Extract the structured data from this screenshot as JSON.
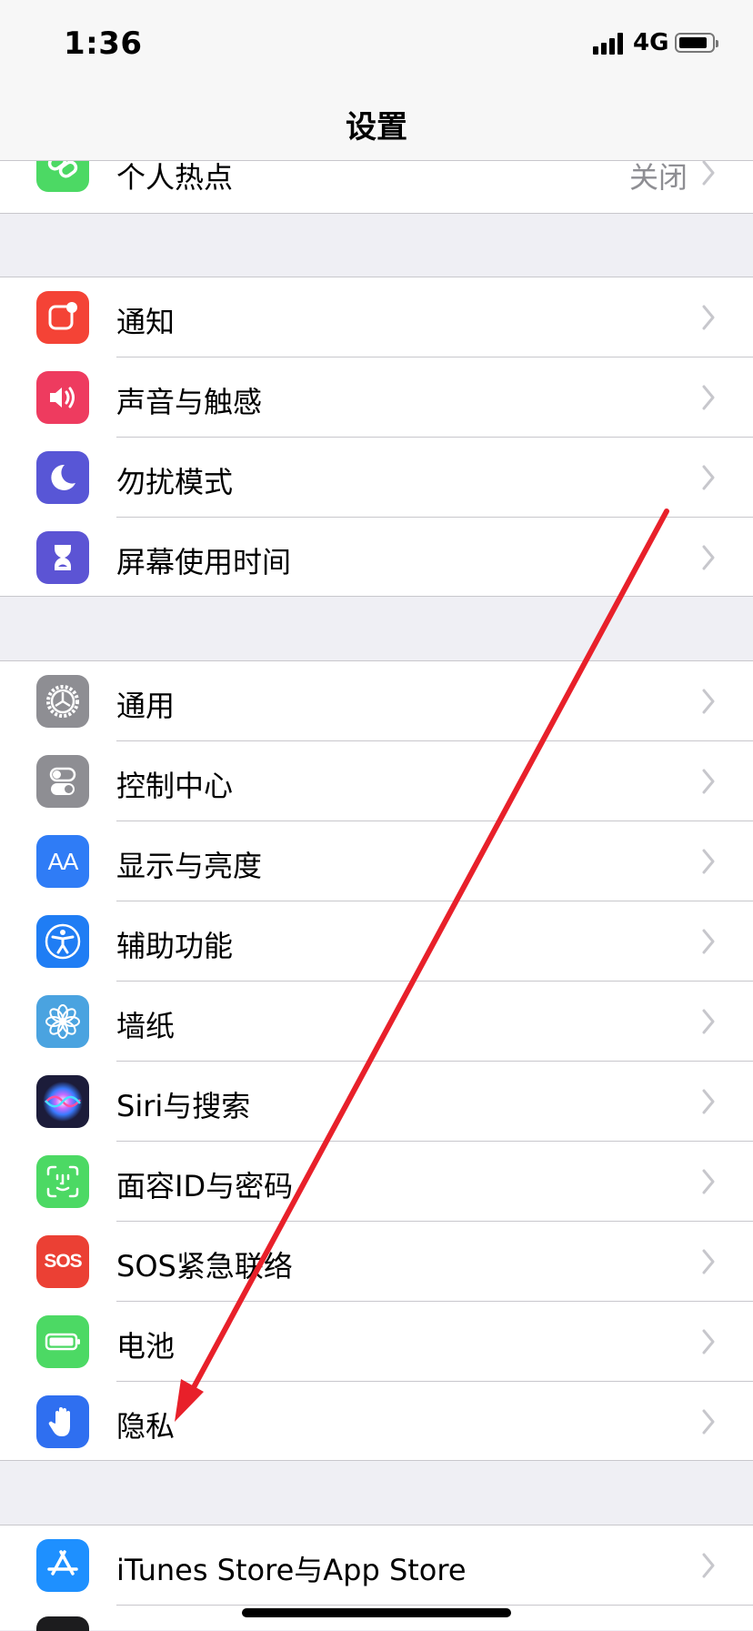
{
  "status_bar": {
    "time": "1:36",
    "network": "4G"
  },
  "nav": {
    "title": "设置"
  },
  "groups": [
    {
      "rows": [
        {
          "label": "个人热点",
          "value": "关闭"
        }
      ]
    },
    {
      "rows": [
        {
          "label": "通知"
        },
        {
          "label": "声音与触感"
        },
        {
          "label": "勿扰模式"
        },
        {
          "label": "屏幕使用时间"
        }
      ]
    },
    {
      "rows": [
        {
          "label": "通用"
        },
        {
          "label": "控制中心"
        },
        {
          "label": "显示与亮度",
          "icon_text": "AA"
        },
        {
          "label": "辅助功能"
        },
        {
          "label": "墙纸"
        },
        {
          "label": "Siri与搜索"
        },
        {
          "label": "面容ID与密码"
        },
        {
          "label": "SOS紧急联络",
          "icon_text": "SOS"
        },
        {
          "label": "电池"
        },
        {
          "label": "隐私"
        }
      ]
    },
    {
      "rows": [
        {
          "label": "iTunes Store与App Store"
        }
      ]
    }
  ],
  "icons": {
    "hotspot": "chain-link-icon",
    "notifications": "notification-badge-icon",
    "sounds": "speaker-icon",
    "dnd": "moon-icon",
    "screentime": "hourglass-icon",
    "general": "gear-icon",
    "control": "toggle-switches-icon",
    "display": "text-size-icon",
    "accessibility": "accessibility-person-icon",
    "wallpaper": "flower-icon",
    "siri": "siri-orb-icon",
    "faceid": "face-id-icon",
    "sos": "sos-icon",
    "battery": "battery-icon",
    "privacy": "hand-icon",
    "appstore": "app-store-icon"
  },
  "colors": {
    "hotspot": "#4cd964",
    "notifications": "#f44336",
    "sounds": "#ee3b5f",
    "dnd": "#5856d6",
    "screentime": "#5c54d4",
    "general": "#8e8e93",
    "control": "#8e8e93",
    "display": "#2f7cf6",
    "accessibility": "#1f7df4",
    "wallpaper": "#4aa3e0",
    "siri": "#1c1c3a",
    "faceid": "#4cd964",
    "sos": "#eb4034",
    "battery": "#4cd964",
    "privacy": "#2f6ff0",
    "appstore": "#1e90ff",
    "annotation_arrow": "#e8202a"
  }
}
